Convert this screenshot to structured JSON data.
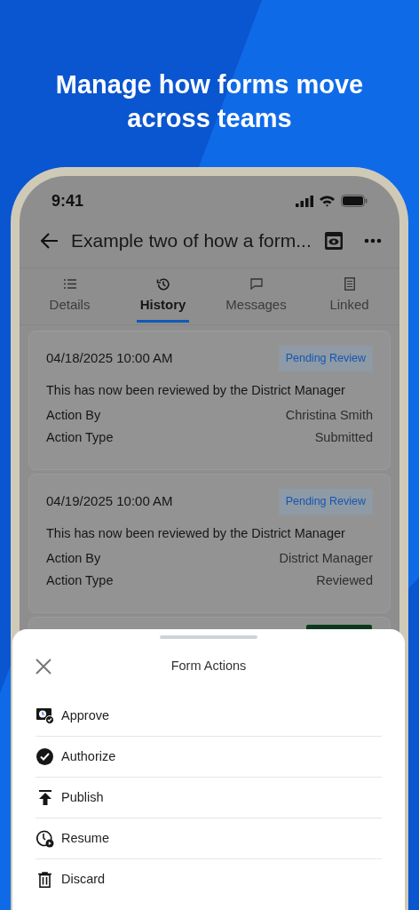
{
  "headline": "Manage how forms move across teams",
  "status_bar": {
    "time": "9:41"
  },
  "app_bar": {
    "title": "Example two of how a form..."
  },
  "tabs": [
    {
      "label": "Details",
      "selected": false
    },
    {
      "label": "History",
      "selected": true
    },
    {
      "label": "Messages",
      "selected": false
    },
    {
      "label": "Linked",
      "selected": false
    }
  ],
  "history": [
    {
      "date": "04/18/2025 10:00 AM",
      "status": "Pending Review",
      "note": "This has now been reviewed by the District Manager",
      "fields": [
        {
          "label": "Action By",
          "value": "Christina Smith"
        },
        {
          "label": "Action Type",
          "value": "Submitted"
        }
      ]
    },
    {
      "date": "04/19/2025 10:00 AM",
      "status": "Pending Review",
      "note": "This has now been reviewed by the District Manager",
      "fields": [
        {
          "label": "Action By",
          "value": "District Manager"
        },
        {
          "label": "Action Type",
          "value": "Reviewed"
        }
      ]
    }
  ],
  "sheet": {
    "title": "Form Actions",
    "actions": [
      {
        "label": "Approve"
      },
      {
        "label": "Authorize"
      },
      {
        "label": "Publish"
      },
      {
        "label": "Resume"
      },
      {
        "label": "Discard"
      }
    ]
  }
}
